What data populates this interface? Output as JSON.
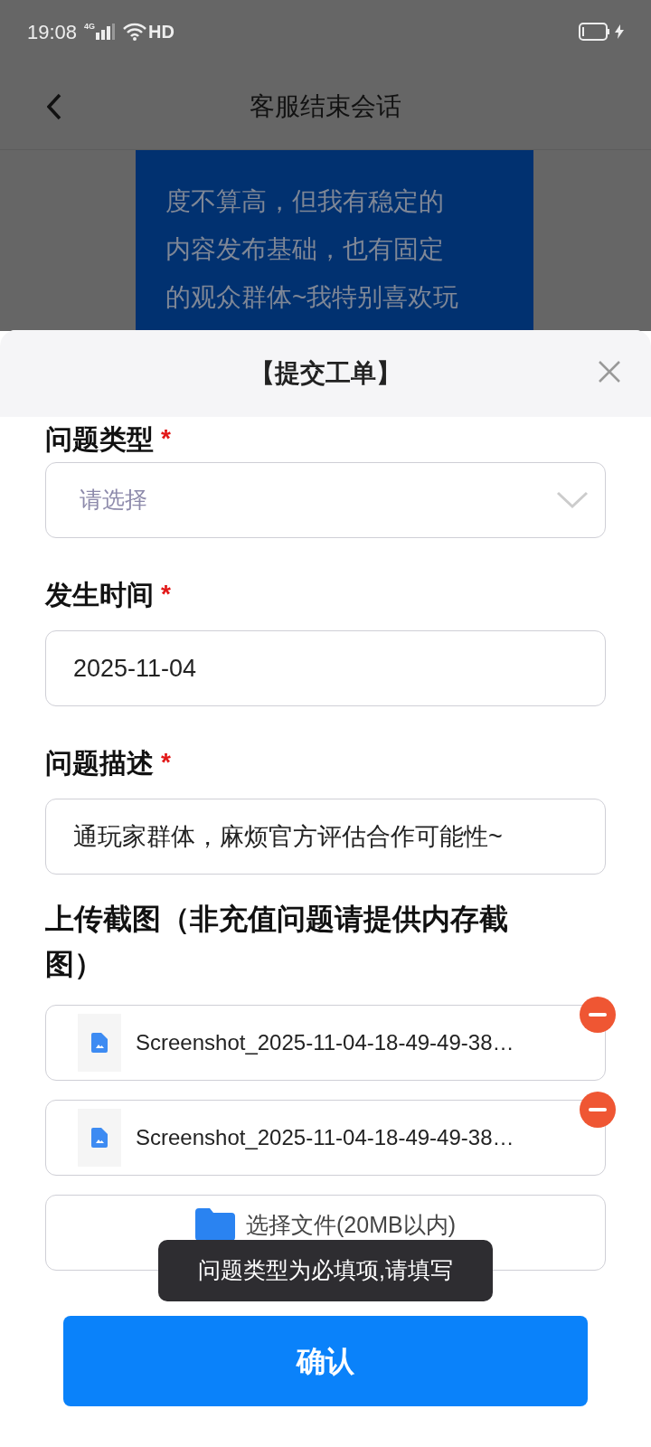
{
  "status_bar": {
    "time": "19:08",
    "network": "4G",
    "wifi_label": "HD"
  },
  "nav": {
    "title": "客服结束会话"
  },
  "chat_bubble": {
    "lines": [
      "度不算高，但我有稳定的",
      "内容发布基础，也有固定",
      "的观众群体~我特别喜欢玩"
    ]
  },
  "sheet": {
    "title": "【提交工单】",
    "fields": [
      {
        "kind": "select",
        "label": "问题类型",
        "required_mark": "*",
        "placeholder": "请选择"
      },
      {
        "kind": "text",
        "label": "发生时间",
        "required_mark": "*",
        "value": "2025-11-04"
      },
      {
        "kind": "text",
        "label": "问题描述",
        "required_mark": "*",
        "value": "通玩家群体，麻烦官方评估合作可能性~"
      }
    ],
    "upload": {
      "label": "上传截图（非充值问题请提供内存截图）",
      "files": [
        {
          "name": "Screenshot_2025-11-04-18-49-49-38…"
        },
        {
          "name": "Screenshot_2025-11-04-18-49-49-38…"
        }
      ],
      "choose_button": "选择文件(20MB以内)"
    },
    "confirm_button": "确认"
  },
  "toast": "问题类型为必填项,请填写"
}
